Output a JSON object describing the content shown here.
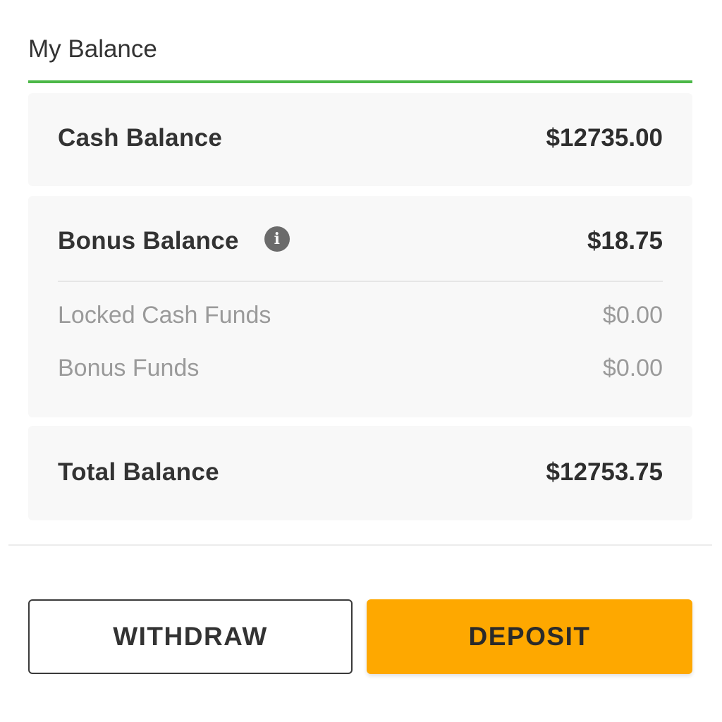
{
  "header": {
    "title": "My Balance",
    "accent_color": "#4cb848"
  },
  "cash": {
    "label": "Cash Balance",
    "value": "$12735.00"
  },
  "bonus": {
    "label": "Bonus Balance",
    "info_icon": "info-icon",
    "info_glyph": "i",
    "value": "$18.75",
    "details": [
      {
        "label": "Locked Cash Funds",
        "value": "$0.00"
      },
      {
        "label": "Bonus Funds",
        "value": "$0.00"
      }
    ]
  },
  "total": {
    "label": "Total Balance",
    "value": "$12753.75"
  },
  "actions": {
    "withdraw_label": "WITHDRAW",
    "deposit_label": "DEPOSIT",
    "deposit_color": "#fea800"
  }
}
